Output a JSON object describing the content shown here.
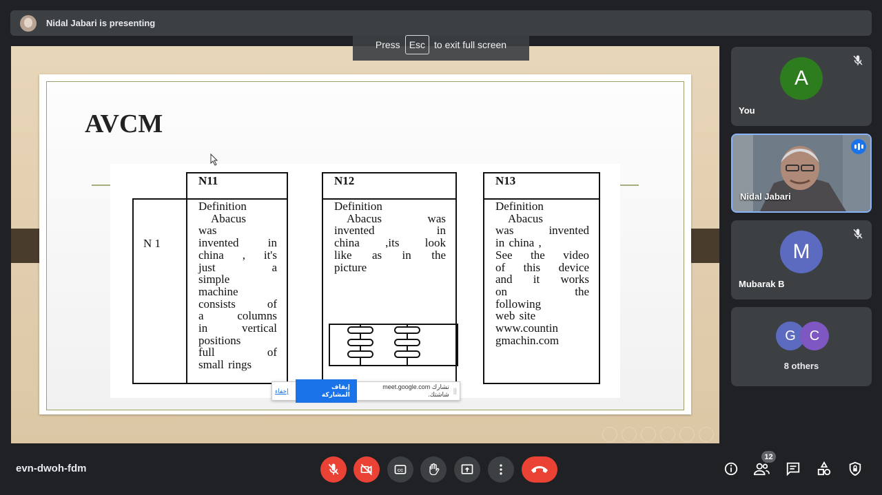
{
  "presenting_bar": {
    "text": "Nidal Jabari is presenting"
  },
  "fullscreen_hint": {
    "press": "Press",
    "key": "Esc",
    "rest": "to exit full screen"
  },
  "slide": {
    "title": "AVCM",
    "row_label": "N 1",
    "columns": [
      {
        "header": "N11",
        "lines": [
          "Definition",
          "  Abacus",
          "was",
          "invented in",
          "china , it's",
          "just a",
          "simple",
          "machine",
          "consists of",
          "a columns",
          "in vertical",
          "positions",
          "full of",
          "small rings"
        ]
      },
      {
        "header": "N12",
        "lines": [
          "Definition",
          "  Abacus was",
          "invented in",
          "china ,its look",
          "like as in the",
          "picture"
        ]
      },
      {
        "header": "N13",
        "lines": [
          "Definition",
          "  Abacus",
          "was invented",
          "in china ,",
          "See the video",
          "of this device",
          "and it works",
          "on the",
          "following",
          "web site",
          "www.countin",
          "gmachin.com"
        ]
      }
    ]
  },
  "share_bar": {
    "grip": "||",
    "message": "تشارك meet.google.com شاشتك.",
    "stop_label": "إيقاف المشاركة",
    "hide_label": "إخفاء"
  },
  "participants": [
    {
      "name": "You",
      "initial": "A",
      "color": "#2d7d1f",
      "muted": true
    },
    {
      "name": "Nidal Jabari",
      "speaking": true
    },
    {
      "name": "Mubarak B",
      "initial": "M",
      "color": "#5c6bc0",
      "muted": true
    },
    {
      "name": "8 others",
      "initials": [
        "G",
        "C"
      ],
      "colors": [
        "#5c6bc0",
        "#7e57c2"
      ]
    }
  ],
  "meeting": {
    "code": "evn-dwoh-fdm",
    "people_count": "12"
  },
  "colors": {
    "accent": "#8ab4f8",
    "danger": "#ea4335",
    "surface": "#3c4043"
  }
}
